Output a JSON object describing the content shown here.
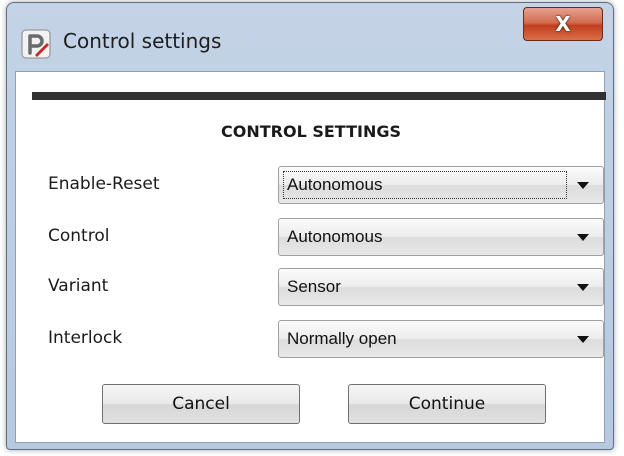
{
  "window": {
    "title": "Control settings",
    "close_glyph": "X",
    "app_icon": "p-app-icon"
  },
  "dialog": {
    "section_title": "CONTROL SETTINGS",
    "fields": [
      {
        "label": "Enable-Reset",
        "value": "Autonomous"
      },
      {
        "label": "Control",
        "value": "Autonomous"
      },
      {
        "label": "Variant",
        "value": "Sensor"
      },
      {
        "label": "Interlock",
        "value": "Normally open"
      }
    ],
    "buttons": {
      "cancel": "Cancel",
      "continue": "Continue"
    }
  },
  "colors": {
    "header_bar": "#323232",
    "close_button": "#c23e1c",
    "frame": "#b7c9df"
  }
}
